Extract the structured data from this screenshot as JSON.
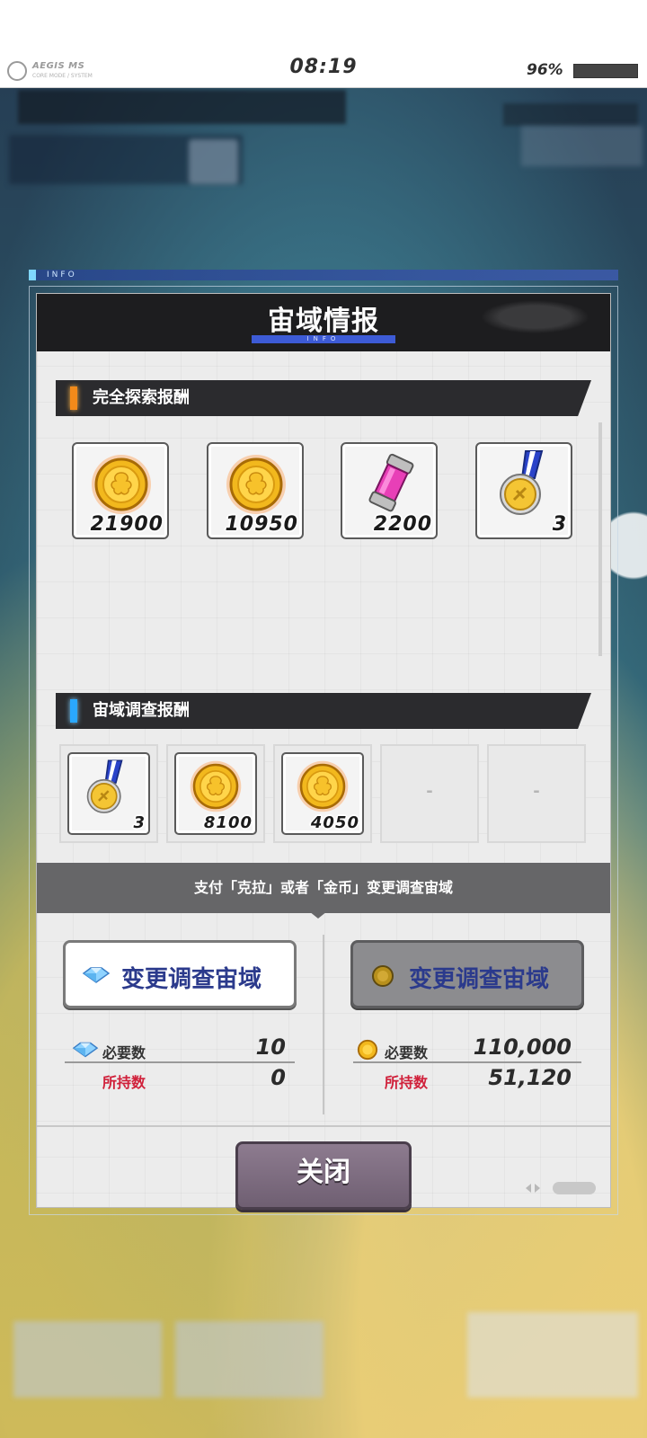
{
  "status_bar": {
    "brand": "AEGIS MS",
    "brand_sub": "CORE MODE / SYSTEM",
    "time": "08:19",
    "battery": "96%"
  },
  "info_strip": "INFO",
  "dialog": {
    "title": "宙域情报",
    "title_sub": "INFO",
    "complete_section": {
      "label": "完全探索报酬",
      "accent": "#f28a1a",
      "items": [
        {
          "icon": "gold-coin-icon",
          "qty": "21900"
        },
        {
          "icon": "gold-coin-icon",
          "qty": "10950"
        },
        {
          "icon": "pink-capsule-icon",
          "qty": "2200"
        },
        {
          "icon": "medal-icon",
          "qty": "3"
        }
      ]
    },
    "survey_section": {
      "label": "宙域调查报酬",
      "accent": "#2aa8ff",
      "items": [
        {
          "icon": "medal-icon",
          "qty": "3"
        },
        {
          "icon": "gold-coin-icon",
          "qty": "8100"
        },
        {
          "icon": "gold-coin-icon",
          "qty": "4050"
        },
        {
          "icon": "empty-slot",
          "qty": "-"
        },
        {
          "icon": "empty-slot",
          "qty": "-"
        }
      ]
    },
    "pay_banner": "支付「克拉」或者「金币」变更调查宙域",
    "gem_option": {
      "button": "变更调查宙域",
      "need_label": "必要数",
      "need_value": "10",
      "have_label": "所持数",
      "have_value": "0"
    },
    "coin_option": {
      "button": "变更调查宙域",
      "need_label": "必要数",
      "need_value": "110,000",
      "have_label": "所持数",
      "have_value": "51,120"
    },
    "close_button": "关闭"
  }
}
